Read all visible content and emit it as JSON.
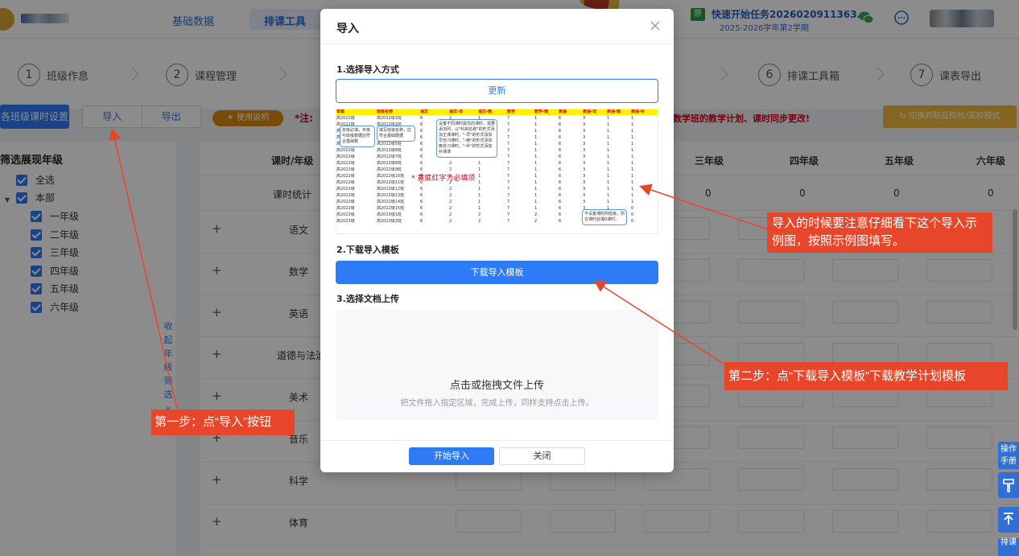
{
  "topnav": {
    "items": [
      "基础数据",
      "排课工具"
    ],
    "task_badge": "原",
    "task_title": "快速开始任务2026020911363...",
    "task_term": "2025-2026学年第2学期"
  },
  "steps": [
    {
      "num": "1",
      "label": "班级作息"
    },
    {
      "num": "2",
      "label": "课程管理"
    },
    {
      "num": "6",
      "label": "排课工具箱"
    },
    {
      "num": "7",
      "label": "课表导出"
    }
  ],
  "toolbar": {
    "class_hours_btn": "各班级课时设置",
    "import_btn": "导入",
    "export_btn": "导出",
    "help_btn": "使用说明",
    "note_prefix": "*注:",
    "note_right": "数学班的教学计划、课时同步更改!",
    "switch_btn": "切换到职业院校/高校模式"
  },
  "filter": {
    "title": "筛选展现年级",
    "select_all": "全选",
    "all_dept": "本部",
    "grades": [
      "一年级",
      "二年级",
      "三年级",
      "四年级",
      "五年级",
      "六年级"
    ],
    "collapse_label": [
      "收",
      "起",
      "年",
      "级",
      "筛",
      "选",
      "«"
    ]
  },
  "table": {
    "header_label": "课时/年级",
    "stats_label": "课时统计",
    "grade_headers": [
      "三年级",
      "四年级",
      "五年级",
      "六年级"
    ],
    "stats_values": [
      "0",
      "0",
      "0",
      "0",
      "0"
    ],
    "subjects": [
      "语文",
      "数学",
      "英语",
      "道德与法治",
      "美术",
      "音乐",
      "科学",
      "体育"
    ]
  },
  "modal": {
    "title": "导入",
    "section1": "1.选择导入方式",
    "update_btn": "更新",
    "section2": "2.下载导入模板",
    "download_btn": "下载导入模板",
    "section3": "3.选择文档上传",
    "upload_main": "点击或拖拽文件上传",
    "upload_sub": "把文件拖入指定区域，完成上传，同样支持点击上传。",
    "start_btn": "开始导入",
    "close_btn": "关闭",
    "example": {
      "header": [
        "年级",
        "班级名称",
        "语文",
        "语文-早",
        "语文-晚",
        "数学",
        "数学-晚",
        "英语",
        "英语-早",
        "英语-晚",
        "英语-补"
      ],
      "rows": [
        [
          "高2022级",
          "高2022级1班",
          "6",
          "2",
          "1",
          "7",
          "1",
          "6",
          "3",
          "1",
          "1"
        ],
        [
          "高2022级",
          "高2022级2班",
          "6",
          "2",
          "1",
          "7",
          "1",
          "6",
          "3",
          "1",
          "1"
        ],
        [
          "高2022级",
          "高2022级3班",
          "6",
          "2",
          "1",
          "7",
          "1",
          "6",
          "3",
          "1",
          "1"
        ],
        [
          "高2022级",
          "高2022级4班",
          "6",
          "2",
          "1",
          "7",
          "1",
          "6",
          "3",
          "1",
          "1"
        ],
        [
          "高2022级",
          "高2022级5班",
          "6",
          "2",
          "1",
          "7",
          "1",
          "6",
          "3",
          "1",
          "1"
        ],
        [
          "高2022级",
          "高2022级6班",
          "6",
          "2",
          "1",
          "7",
          "1",
          "6",
          "3",
          "1",
          "1"
        ],
        [
          "高2022级",
          "高2022级7班",
          "6",
          "2",
          "1",
          "7",
          "1",
          "6",
          "3",
          "1",
          "1"
        ],
        [
          "高2022级",
          "高2022级8班",
          "6",
          "2",
          "1",
          "7",
          "1",
          "6",
          "3",
          "1",
          "1"
        ],
        [
          "高2022级",
          "高2022级9班",
          "6",
          "2",
          "1",
          "7",
          "1",
          "6",
          "3",
          "1",
          "1"
        ],
        [
          "高2022级",
          "高2022级10班",
          "6",
          "2",
          "1",
          "7",
          "1",
          "6",
          "3",
          "1",
          "1"
        ],
        [
          "高2022级",
          "高2022级11班",
          "6",
          "2",
          "1",
          "7",
          "1",
          "6",
          "3",
          "1",
          "1"
        ],
        [
          "高2022级",
          "高2022级12班",
          "6",
          "2",
          "1",
          "7",
          "1",
          "6",
          "3",
          "1",
          "1"
        ],
        [
          "高2022级",
          "高2022级13班",
          "6",
          "2",
          "1",
          "7",
          "1",
          "6",
          "3",
          "1",
          "1"
        ],
        [
          "高2022级",
          "高2022级14班",
          "6",
          "2",
          "1",
          "7",
          "1",
          "6",
          "3",
          "1",
          "1"
        ],
        [
          "高2022级",
          "高2022级15班",
          "6",
          "2",
          "1",
          "7",
          "1",
          "6",
          "3",
          "1",
          "0"
        ],
        [
          "高2023级",
          "高2023级1班",
          "6",
          "2",
          "2",
          "7",
          "2",
          "6",
          "3",
          "2",
          "0"
        ],
        [
          "高2023级",
          "高2023级2班",
          "6",
          "2",
          "2",
          "7",
          "2",
          "6",
          "3",
          "2",
          "0"
        ]
      ],
      "callout1": "年级必填，年级与班级数据应符合基础数",
      "callout2": "填写班级名称，应符合基础数据",
      "callout3": "设置不同课时属性的课时，需要添加列，以\"科目名称\"的形式添加正课课时，\"-早\"的形式添加早自习课时，\"-晚\"的形式添加晚自习课时，\"-补\"的形式添加补课课",
      "callout4": "不设置课时的班级，则在课时处填0课时。",
      "note": "* 黄底红字为必填项"
    }
  },
  "annotations": {
    "step1": "第一步：点“导入”按钮",
    "tip": "导入的时候要注意仔细看下这个导入示例图，按照示例图填写。",
    "step2": "第二步：点“下载导入模板”下载教学计划模板"
  },
  "floating": {
    "manual": "操作手册",
    "bottom": "排课"
  },
  "colors": {
    "primary": "#2f7bf5",
    "annotation": "#e8462b",
    "warning": "#d0021b",
    "help": "#d98a12"
  }
}
